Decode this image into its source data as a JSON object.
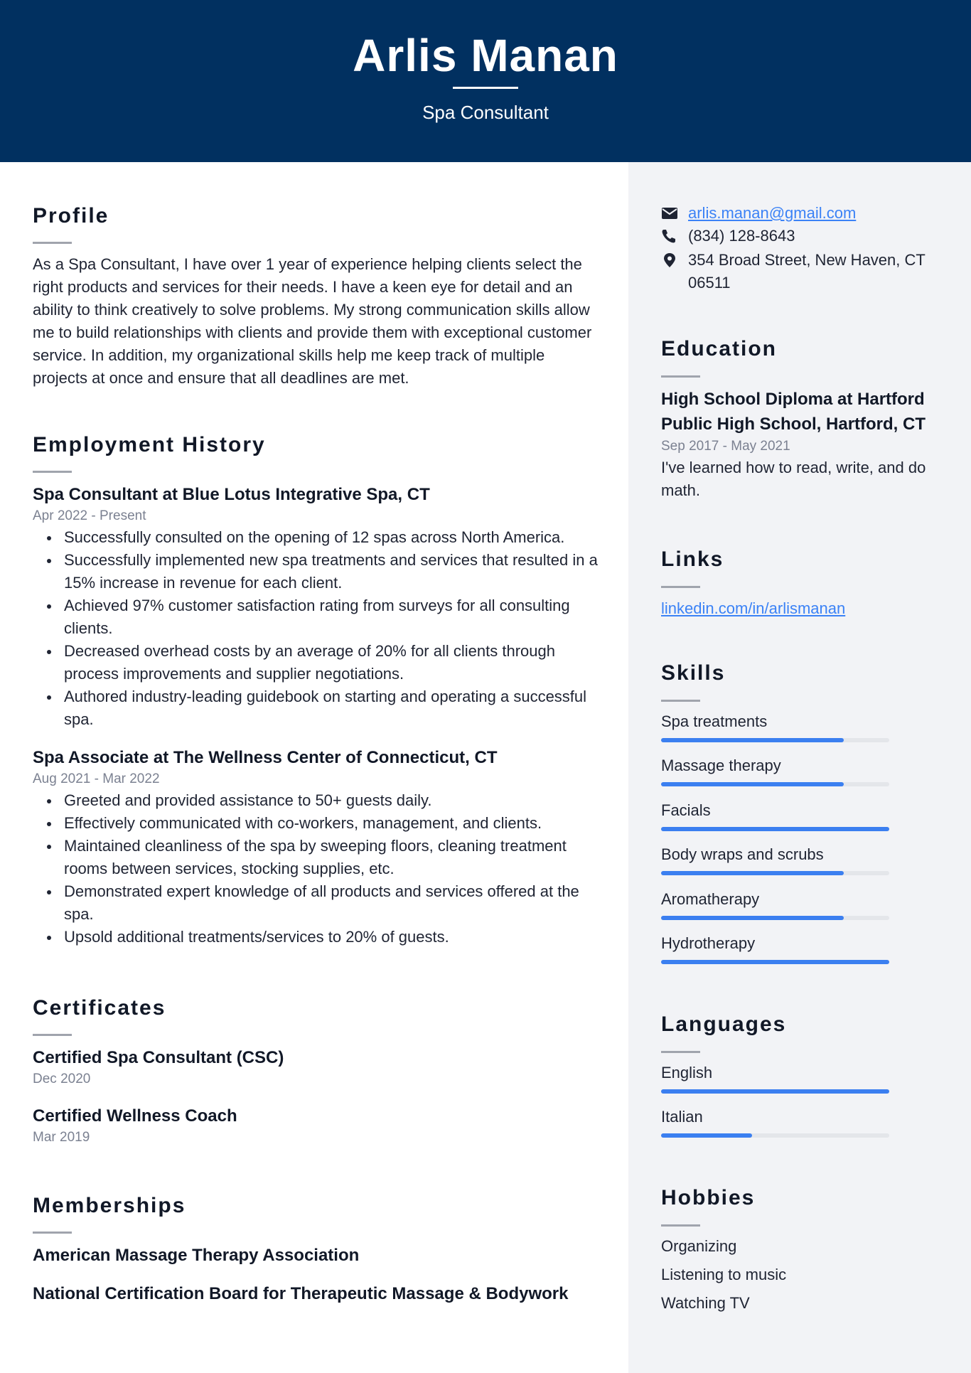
{
  "header": {
    "name": "Arlis Manan",
    "title": "Spa Consultant",
    "background_color": "#013060"
  },
  "profile": {
    "heading": "Profile",
    "text": "As a Spa Consultant, I have over 1 year of experience helping clients select the right products and services for their needs. I have a keen eye for detail and an ability to think creatively to solve problems. My strong communication skills allow me to build relationships with clients and provide them with exceptional customer service. In addition, my organizational skills help me keep track of multiple projects at once and ensure that all deadlines are met."
  },
  "employment": {
    "heading": "Employment History",
    "jobs": [
      {
        "title": "Spa Consultant at Blue Lotus Integrative Spa, CT",
        "dates": "Apr 2022 - Present",
        "bullets": [
          "Successfully consulted on the opening of 12 spas across North America.",
          "Successfully implemented new spa treatments and services that resulted in a 15% increase in revenue for each client.",
          "Achieved 97% customer satisfaction rating from surveys for all consulting clients.",
          "Decreased overhead costs by an average of 20% for all clients through process improvements and supplier negotiations.",
          "Authored industry-leading guidebook on starting and operating a successful spa."
        ]
      },
      {
        "title": "Spa Associate at The Wellness Center of Connecticut, CT",
        "dates": "Aug 2021 - Mar 2022",
        "bullets": [
          "Greeted and provided assistance to 50+ guests daily.",
          "Effectively communicated with co-workers, management, and clients.",
          "Maintained cleanliness of the spa by sweeping floors, cleaning treatment rooms between services, stocking supplies, etc.",
          "Demonstrated expert knowledge of all products and services offered at the spa.",
          "Upsold additional treatments/services to 20% of guests."
        ]
      }
    ]
  },
  "certificates": {
    "heading": "Certificates",
    "items": [
      {
        "name": "Certified Spa Consultant (CSC)",
        "date": "Dec 2020"
      },
      {
        "name": "Certified Wellness Coach",
        "date": "Mar 2019"
      }
    ]
  },
  "memberships": {
    "heading": "Memberships",
    "items": [
      "American Massage Therapy Association",
      "National Certification Board for Therapeutic Massage & Bodywork"
    ]
  },
  "contact": {
    "email": "arlis.manan@gmail.com",
    "email_icon": "envelope-icon",
    "phone": "(834) 128-8643",
    "phone_icon": "phone-icon",
    "address": "354 Broad Street, New Haven, CT 06511",
    "address_icon": "map-pin-icon"
  },
  "education": {
    "heading": "Education",
    "degree": "High School Diploma at Hartford Public High School, Hartford, CT",
    "dates": "Sep 2017 - May 2021",
    "description": "I've learned how to read, write, and do math."
  },
  "links": {
    "heading": "Links",
    "items": [
      "linkedin.com/in/arlismanan"
    ]
  },
  "skills": {
    "heading": "Skills",
    "accent_color": "#3b7ff0",
    "items": [
      {
        "name": "Spa treatments",
        "level": 0.8
      },
      {
        "name": "Massage therapy",
        "level": 0.8
      },
      {
        "name": "Facials",
        "level": 1.0
      },
      {
        "name": "Body wraps and scrubs",
        "level": 0.8
      },
      {
        "name": "Aromatherapy",
        "level": 0.8
      },
      {
        "name": "Hydrotherapy",
        "level": 1.0
      }
    ]
  },
  "languages": {
    "heading": "Languages",
    "items": [
      {
        "name": "English",
        "level": 1.0
      },
      {
        "name": "Italian",
        "level": 0.4
      }
    ]
  },
  "hobbies": {
    "heading": "Hobbies",
    "items": [
      "Organizing",
      "Listening to music",
      "Watching TV"
    ]
  }
}
